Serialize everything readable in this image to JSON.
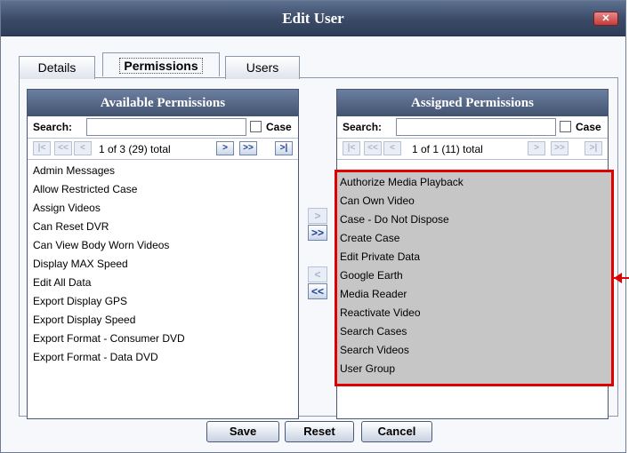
{
  "dialog": {
    "title": "Edit User",
    "close_label": "✕"
  },
  "tabs": [
    {
      "label": "Details",
      "active": false
    },
    {
      "label": "Permissions",
      "active": true
    },
    {
      "label": "Users",
      "active": false
    }
  ],
  "available": {
    "header": "Available Permissions",
    "search_label": "Search:",
    "search_value": "",
    "case_label": "Case",
    "case_checked": false,
    "pager_text": "1 of 3 (29) total",
    "items": [
      "Admin Messages",
      "Allow Restricted Case",
      "Assign Videos",
      "Can Reset DVR",
      "Can View Body Worn Videos",
      "Display MAX Speed",
      "Edit All Data",
      "Export Display GPS",
      "Export Display Speed",
      "Export Format - Consumer DVD",
      "Export Format - Data DVD"
    ]
  },
  "assigned": {
    "header": "Assigned Permissions",
    "search_label": "Search:",
    "search_value": "",
    "case_label": "Case",
    "case_checked": false,
    "pager_text": "1 of 1 (11) total",
    "items": [
      "Authorize Media Playback",
      "Can Own Video",
      "Case - Do Not Dispose",
      "Create Case",
      "Edit Private Data",
      "Google Earth",
      "Media Reader",
      "Reactivate Video",
      "Search Cases",
      "Search Videos",
      "User Group"
    ]
  },
  "pager_icons": {
    "first": "|<",
    "prev_page": "<<",
    "prev": "<",
    "next": ">",
    "next_page": ">>",
    "last": ">|"
  },
  "transfer_icons": {
    "add": ">",
    "add_all": ">>",
    "remove": "<",
    "remove_all": "<<"
  },
  "buttons": {
    "save": "Save",
    "reset": "Reset",
    "cancel": "Cancel"
  },
  "colors": {
    "highlight_frame": "#e00000",
    "selection_fill": "#c6c6c6",
    "header_bar": "#4a5b78"
  }
}
